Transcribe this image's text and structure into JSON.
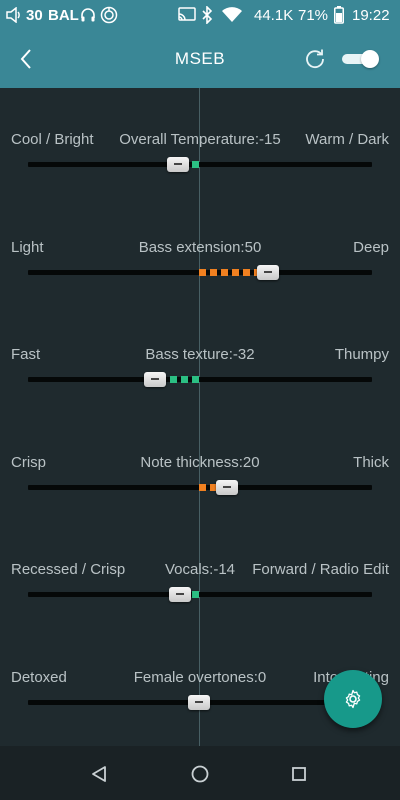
{
  "status_bar": {
    "volume_value": "30",
    "balance_label": "BAL",
    "sample_rate": "44.1K",
    "battery_percent": "71%",
    "time": "19:22"
  },
  "app_bar": {
    "title": "MSEB",
    "toggle_on": true
  },
  "sliders": [
    {
      "left": "Cool / Bright",
      "center": "Overall Temperature:-15",
      "right": "Warm / Dark",
      "value": -15,
      "dot_color": "#2bbf83"
    },
    {
      "left": "Light",
      "center": "Bass extension:50",
      "right": "Deep",
      "value": 50,
      "dot_color": "#f08020"
    },
    {
      "left": "Fast",
      "center": "Bass texture:-32",
      "right": "Thumpy",
      "value": -32,
      "dot_color": "#2bbf83"
    },
    {
      "left": "Crisp",
      "center": "Note thickness:20",
      "right": "Thick",
      "value": 20,
      "dot_color": "#f08020"
    },
    {
      "left": "Recessed / Crisp",
      "center": "Vocals:-14",
      "right": "Forward / Radio Edit",
      "value": -14,
      "dot_color": "#2bbf83"
    },
    {
      "left": "Detoxed",
      "center": "Female overtones:0",
      "right": "Intoxicating",
      "value": 0,
      "dot_color": "#2bbf83"
    }
  ],
  "colors": {
    "accent": "#3a8796",
    "fab": "#17998a",
    "background": "#1f2a2e",
    "positive": "#f08020",
    "negative": "#2bbf83"
  },
  "icons": {
    "back": "chevron-left-icon",
    "reset": "refresh-icon",
    "fab": "gear-icon",
    "nav_back": "triangle-back-icon",
    "nav_home": "circle-home-icon",
    "nav_recents": "square-recents-icon"
  }
}
